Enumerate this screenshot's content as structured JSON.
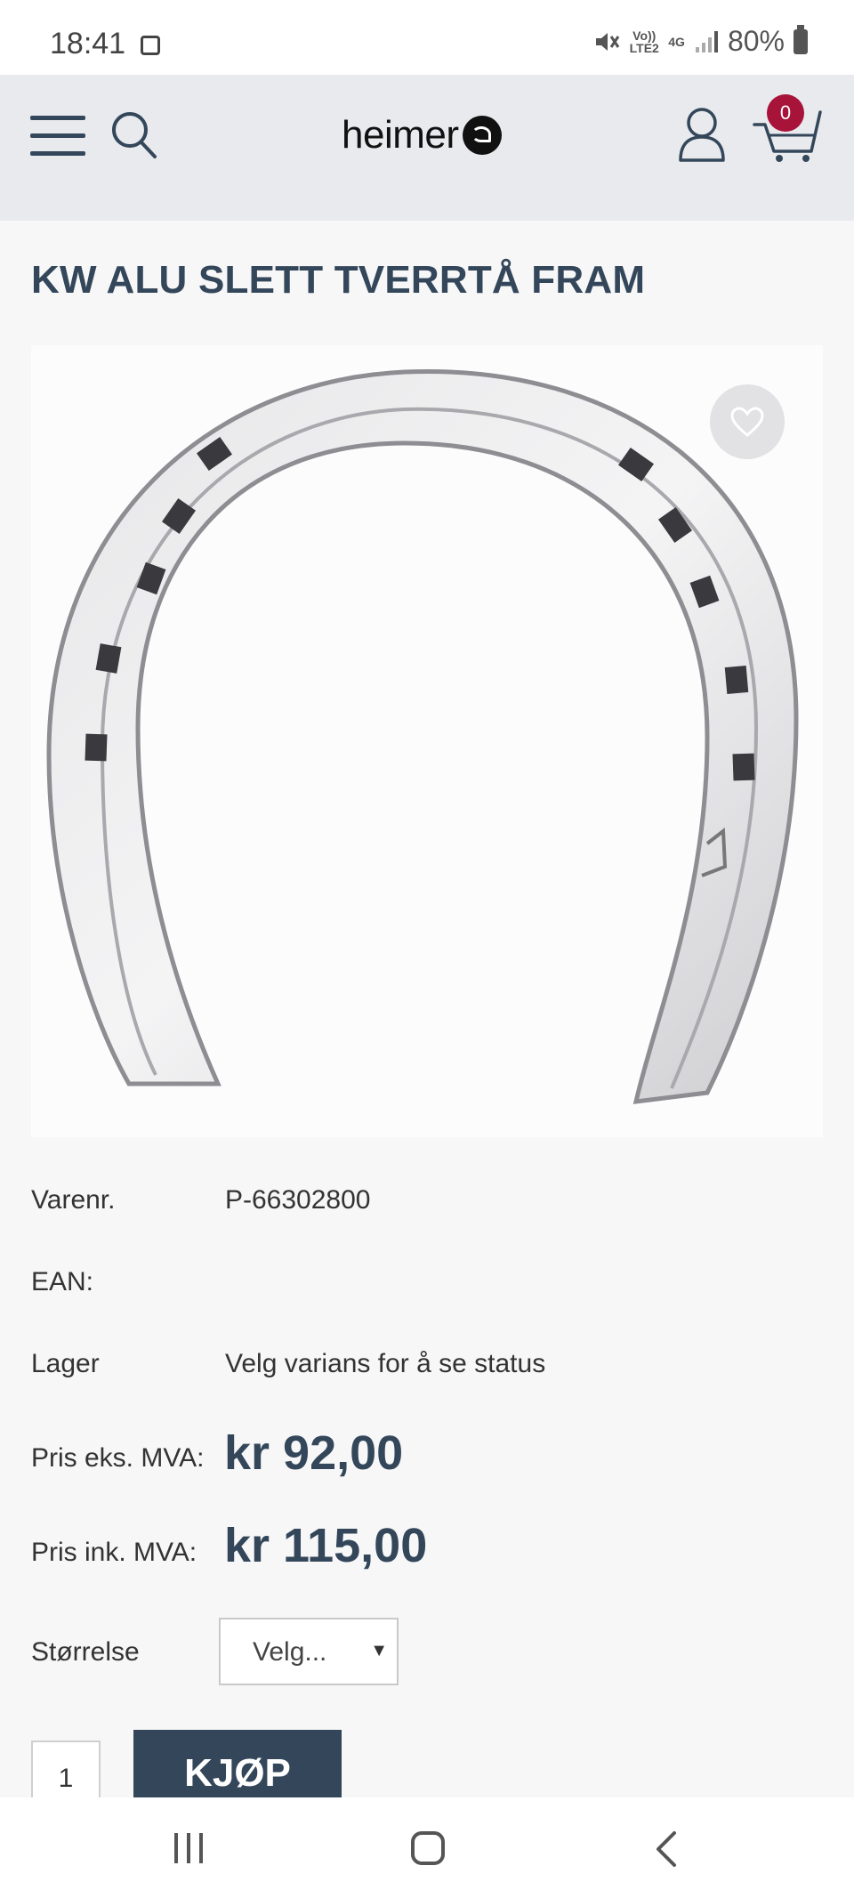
{
  "status_bar": {
    "time": "18:41",
    "network_label_top": "Vo)) LTE2",
    "network_label_4g": "4G",
    "battery": "80%"
  },
  "header": {
    "logo_text": "heimer",
    "cart_count": "0"
  },
  "product": {
    "title": "KW ALU SLETT TVERRTÅ FRAM",
    "image_icon": "horseshoe-image",
    "details": [
      {
        "label": "Varenr.",
        "value": "P-66302800"
      },
      {
        "label": "EAN:",
        "value": ""
      },
      {
        "label": "Lager",
        "value": "Velg varians for å se status"
      }
    ],
    "price_ex_label": "Pris eks. MVA:",
    "price_ex_value": "kr 92,00",
    "price_inc_label": "Pris ink. MVA:",
    "price_inc_value": "kr 115,00",
    "size_label": "Størrelse",
    "size_selected": "Velg...",
    "quantity": "1",
    "buy_label": "KJØP"
  },
  "colors": {
    "primary": "#34475a",
    "badge": "#a8133a",
    "header_bg": "#e8eaee"
  }
}
